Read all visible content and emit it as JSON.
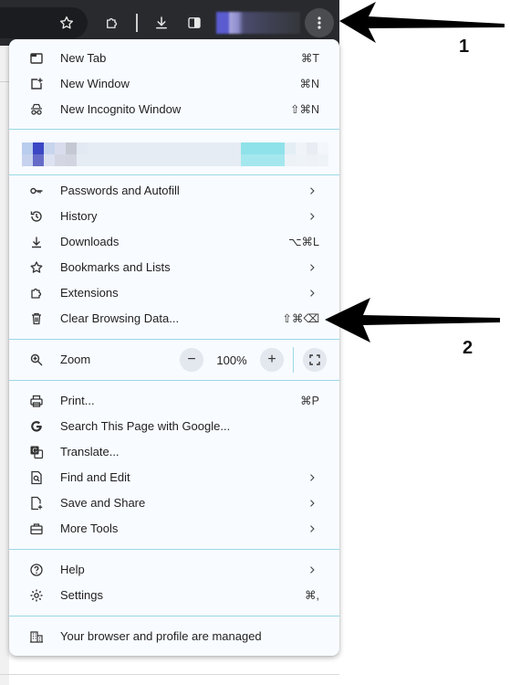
{
  "menu": {
    "group1": [
      {
        "name": "menu-item-new-tab",
        "icon": "new-tab-icon",
        "label": "New Tab",
        "shortcut": "⌘T"
      },
      {
        "name": "menu-item-new-window",
        "icon": "new-window-icon",
        "label": "New Window",
        "shortcut": "⌘N"
      },
      {
        "name": "menu-item-new-incognito",
        "icon": "incognito-icon",
        "label": "New Incognito Window",
        "shortcut": "⇧⌘N"
      }
    ],
    "group2": [
      {
        "name": "menu-item-passwords",
        "icon": "key-icon",
        "label": "Passwords and Autofill",
        "submenu": true
      },
      {
        "name": "menu-item-history",
        "icon": "history-icon",
        "label": "History",
        "submenu": true
      },
      {
        "name": "menu-item-downloads",
        "icon": "download-icon",
        "label": "Downloads",
        "shortcut": "⌥⌘L"
      },
      {
        "name": "menu-item-bookmarks",
        "icon": "star-icon",
        "label": "Bookmarks and Lists",
        "submenu": true
      },
      {
        "name": "menu-item-extensions",
        "icon": "puzzle-icon",
        "label": "Extensions",
        "submenu": true
      },
      {
        "name": "menu-item-clear-data",
        "icon": "trash-icon",
        "label": "Clear Browsing Data...",
        "shortcut": "⇧⌘⌫"
      }
    ],
    "zoom": {
      "label": "Zoom",
      "value": "100%",
      "minus": "−",
      "plus": "+"
    },
    "group3": [
      {
        "name": "menu-item-print",
        "icon": "printer-icon",
        "label": "Print...",
        "shortcut": "⌘P"
      },
      {
        "name": "menu-item-search-page",
        "icon": "google-icon",
        "label": "Search This Page with Google..."
      },
      {
        "name": "menu-item-translate",
        "icon": "translate-icon",
        "label": "Translate..."
      },
      {
        "name": "menu-item-find-edit",
        "icon": "find-icon",
        "label": "Find and Edit",
        "submenu": true
      },
      {
        "name": "menu-item-save-share",
        "icon": "save-share-icon",
        "label": "Save and Share",
        "submenu": true
      },
      {
        "name": "menu-item-more-tools",
        "icon": "toolbox-icon",
        "label": "More Tools",
        "submenu": true
      }
    ],
    "group4": [
      {
        "name": "menu-item-help",
        "icon": "help-icon",
        "label": "Help",
        "submenu": true
      },
      {
        "name": "menu-item-settings",
        "icon": "gear-icon",
        "label": "Settings",
        "shortcut": "⌘,"
      }
    ],
    "managed": {
      "icon": "building-icon",
      "label": "Your browser and profile are managed"
    }
  },
  "annotations": {
    "n1": "1",
    "n2": "2"
  },
  "colors": {
    "menu_bg": "#f8fbff",
    "separator": "#9bd8e6",
    "toolbar": "#282a2e",
    "arrow": "#000000"
  }
}
